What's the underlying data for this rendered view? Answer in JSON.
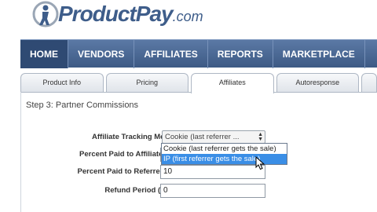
{
  "brand": {
    "name": "ProductPay",
    "suffix": ".com"
  },
  "nav": {
    "items": [
      {
        "label": "HOME",
        "active": true
      },
      {
        "label": "VENDORS",
        "active": false
      },
      {
        "label": "AFFILIATES",
        "active": false
      },
      {
        "label": "REPORTS",
        "active": false
      },
      {
        "label": "MARKETPLACE",
        "active": false
      }
    ]
  },
  "tabs": [
    {
      "label": "Product Info",
      "active": false
    },
    {
      "label": "Pricing",
      "active": false
    },
    {
      "label": "Affiliates",
      "active": true
    },
    {
      "label": "Autoresponse",
      "active": false
    }
  ],
  "step_title": "Step 3: Partner Commissions",
  "form": {
    "tracking_method": {
      "label": "Affiliate Tracking Method",
      "value": "Cookie (last referrer ...",
      "options": [
        {
          "label": "Cookie (last referrer gets the sale)",
          "selected": false
        },
        {
          "label": "IP (first referrer gets the sale)",
          "selected": true
        }
      ]
    },
    "percent_affiliates": {
      "label": "Percent Paid to Affiliates (%)",
      "value": ""
    },
    "percent_referrers": {
      "label": "Percent Paid to Referrers (%)",
      "value": "10"
    },
    "refund_period": {
      "label": "Refund Period (Days)",
      "value": "0"
    }
  },
  "colors": {
    "navbar": "#4a6794",
    "nav_active": "#2f4a73",
    "brand": "#3e5d8a",
    "selected_option": "#3a8ee6"
  }
}
